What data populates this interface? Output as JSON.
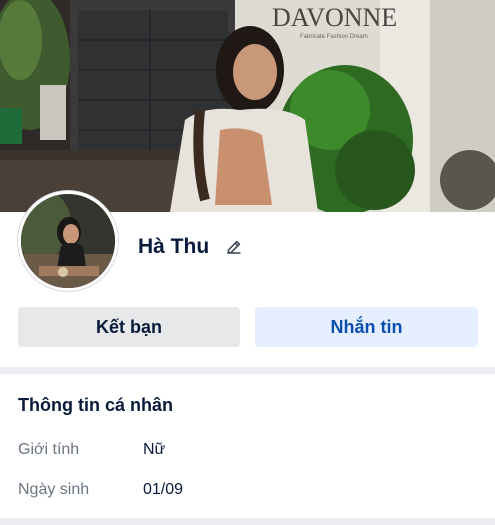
{
  "cover": {
    "sign_text": "DAVONNE",
    "sign_subtext": "Fabricate Fashion Dream"
  },
  "profile": {
    "name": "Hà Thu"
  },
  "actions": {
    "add_friend": "Kết bạn",
    "message": "Nhắn tin"
  },
  "info": {
    "title": "Thông tin cá nhân",
    "rows": [
      {
        "label": "Giới tính",
        "value": "Nữ"
      },
      {
        "label": "Ngày sinh",
        "value": "01/09"
      }
    ]
  },
  "colors": {
    "primary_text": "#081b3a",
    "secondary_text": "#6b7582",
    "message_button_bg": "#e5efff",
    "message_button_text": "#0a4fb0",
    "friend_button_bg": "#e6e8ea",
    "divider": "#edeef2"
  }
}
